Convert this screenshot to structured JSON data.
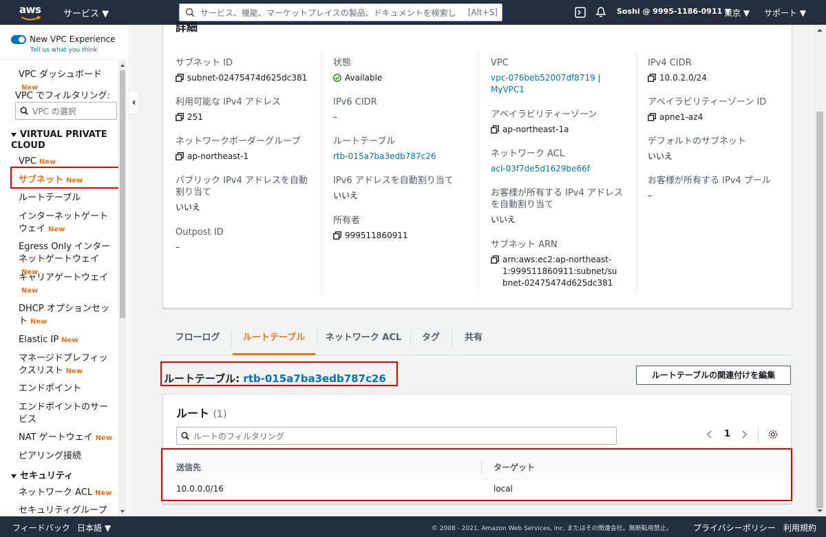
{
  "nav": {
    "logo": "aws",
    "services": "サービス ▼",
    "search_placeholder": "サービス、機能、マーケットプレイスの製品、ドキュメントを検索し",
    "search_hint": "[Alt+S]",
    "user": "Soshi @ 9995-1186-0911 ▼",
    "region": "東京 ▼",
    "support": "サポート ▼"
  },
  "sidebar": {
    "vpc_experience": "New VPC Experience",
    "tell_us": "Tell us what you think",
    "dashboard": "VPC ダッシュボード",
    "filter_label": "VPC でフィルタリング:",
    "filter_placeholder": "VPC の選択",
    "section_vpc": "VIRTUAL PRIVATE CLOUD",
    "new_badge": "New",
    "items": [
      {
        "label": "VPC"
      },
      {
        "label": "サブネット"
      },
      {
        "label": "ルートテーブル"
      },
      {
        "label": "インターネットゲートウェイ"
      },
      {
        "label": "Egress Only インターネットゲートウェイ"
      },
      {
        "label": "キャリアゲートウェイ"
      },
      {
        "label": "DHCP オプションセット"
      },
      {
        "label": "Elastic IP"
      },
      {
        "label": "マネージドプレフィックスリスト"
      },
      {
        "label": "エンドポイント"
      },
      {
        "label": "エンドポイントのサービス"
      },
      {
        "label": "NAT ゲートウェイ"
      },
      {
        "label": "ピアリング接続"
      }
    ],
    "section_security": "セキュリティ",
    "security_items": [
      {
        "label": "ネットワーク ACL"
      },
      {
        "label": "セキュリティグループ"
      }
    ]
  },
  "details": {
    "title": "詳細",
    "subnet_id_label": "サブネット ID",
    "subnet_id": "subnet-02475474d625dc381",
    "available_ipv4_label": "利用可能な IPv4 アドレス",
    "available_ipv4": "251",
    "border_group_label": "ネットワークボーダーグループ",
    "border_group": "ap-northeast-1",
    "auto_public_ipv4_label": "パブリック IPv4 アドレスを自動割り当て",
    "auto_public_ipv4": "いいえ",
    "outpost_label": "Outpost ID",
    "outpost": "–",
    "state_label": "状態",
    "state": "Available",
    "ipv6_cidr_label": "IPv6 CIDR",
    "ipv6_cidr": "–",
    "route_table_label": "ルートテーブル",
    "route_table": "rtb-015a7ba3edb787c26",
    "auto_ipv6_label": "IPv6 アドレスを自動割り当て",
    "auto_ipv6": "いいえ",
    "owner_label": "所有者",
    "owner": "999511860911",
    "vpc_label": "VPC",
    "vpc": "vpc-076beb52007df8719 | MyVPC1",
    "az_label": "アベイラビリティーゾーン",
    "az": "ap-northeast-1a",
    "nacl_label": "ネットワーク ACL",
    "nacl": "acl-03f7de5d1629be66f",
    "customer_ipv4_label": "お客様が所有する IPv4 アドレスを自動割り当て",
    "customer_ipv4": "いいえ",
    "arn_label": "サブネット ARN",
    "arn": "arn:aws:ec2:ap-northeast-1:999511860911:subnet/subnet-02475474d625dc381",
    "ipv4_cidr_label": "IPv4 CIDR",
    "ipv4_cidr": "10.0.2.0/24",
    "az_id_label": "アベイラビリティーゾーン ID",
    "az_id": "apne1-az4",
    "default_subnet_label": "デフォルトのサブネット",
    "default_subnet": "いいえ",
    "customer_pool_label": "お客様が所有する IPv4 プール",
    "customer_pool": "–"
  },
  "tabs": [
    {
      "label": "フローログ"
    },
    {
      "label": "ルートテーブル"
    },
    {
      "label": "ネットワーク ACL"
    },
    {
      "label": "タグ"
    },
    {
      "label": "共有"
    }
  ],
  "route_table": {
    "heading": "ルートテーブル:",
    "id": "rtb-015a7ba3edb787c26",
    "edit_button": "ルートテーブルの関連付けを編集"
  },
  "routes": {
    "title": "ルート",
    "count": "(1)",
    "filter_placeholder": "ルートのフィルタリング",
    "page": "1",
    "headers": [
      "送信先",
      "ターゲット"
    ],
    "rows": [
      {
        "destination": "10.0.0.0/16",
        "target": "local"
      }
    ]
  },
  "footer": {
    "feedback": "フィードバック",
    "language": "日本語 ▼",
    "copyright": "© 2008 - 2021, Amazon Web Services, Inc. またはその関連会社。無断転用禁止。",
    "privacy": "プライバシーポリシー",
    "terms": "利用規約"
  }
}
